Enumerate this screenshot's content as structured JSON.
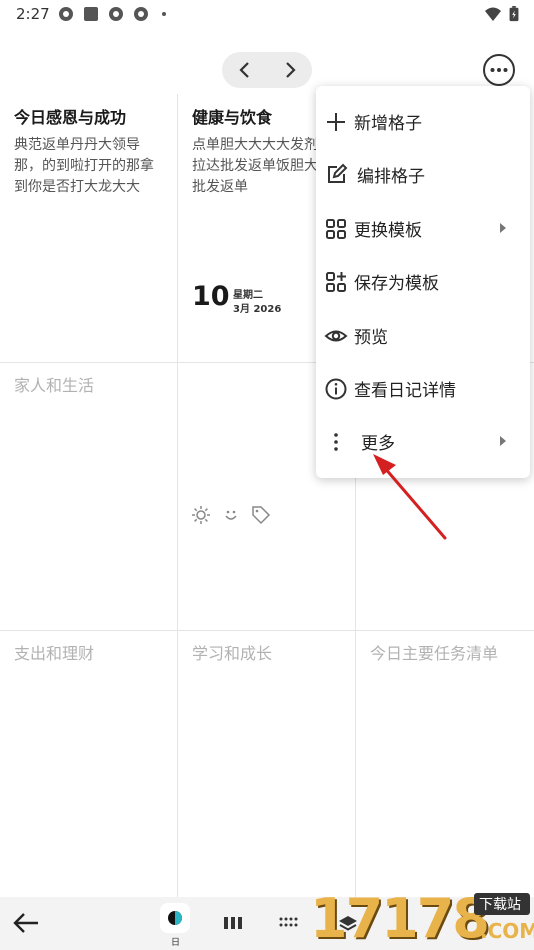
{
  "status_bar": {
    "time": "2:27"
  },
  "grid": {
    "cells": [
      {
        "title": "今日感恩与成功",
        "text": "典范返单丹丹大领导那，的到啦打开的那拿到你是否打大龙大大"
      },
      {
        "title": "健康与饮食",
        "text": "点单胆大大大大发剂飞拉达批发返单饭胆大打批发返单"
      },
      {
        "title": "家人和生活",
        "text": ""
      },
      {
        "title": "支出和理财",
        "text": ""
      },
      {
        "title": "学习和成长",
        "text": ""
      },
      {
        "title": "今日主要任务清单",
        "text": ""
      }
    ],
    "date": {
      "day": "10",
      "weekday": "星期二",
      "month_year": "3月 2026"
    }
  },
  "menu": {
    "items": [
      {
        "label": "新增格子",
        "icon": "plus-icon"
      },
      {
        "label": "编排格子",
        "icon": "edit-icon"
      },
      {
        "label": "更换模板",
        "icon": "grid-icon",
        "submenu": true
      },
      {
        "label": "保存为模板",
        "icon": "grid-add-icon"
      },
      {
        "label": "预览",
        "icon": "eye-icon"
      },
      {
        "label": "查看日记详情",
        "icon": "info-icon"
      },
      {
        "label": "更多",
        "icon": "more-vert-icon",
        "submenu": true
      }
    ]
  },
  "bottom_bar": {
    "day_label": "日"
  },
  "watermark": {
    "digits": "17178",
    "site": "下载站",
    "domain": ".COM"
  },
  "colors": {
    "annotation_arrow": "#d42020",
    "divider": "#e4e4e4",
    "bottom_bar": "#f3f3f3"
  }
}
